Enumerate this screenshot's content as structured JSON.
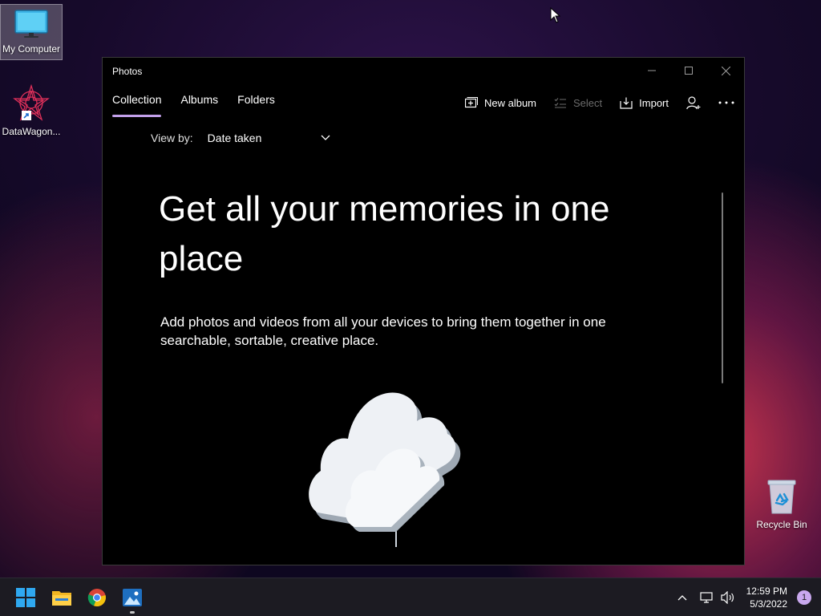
{
  "desktop": {
    "icons": [
      {
        "label": "My Computer",
        "icon": "monitor-icon"
      },
      {
        "label": "DataWagon...",
        "icon": "datawagon-icon"
      },
      {
        "label": "Recycle Bin",
        "icon": "recycle-bin-icon"
      }
    ]
  },
  "window": {
    "title": "Photos",
    "tabs": [
      {
        "label": "Collection",
        "active": true
      },
      {
        "label": "Albums",
        "active": false
      },
      {
        "label": "Folders",
        "active": false
      }
    ],
    "toolbar": {
      "new_album": "New album",
      "select": "Select",
      "import": "Import"
    },
    "view_by": {
      "label": "View by:",
      "value": "Date taken"
    },
    "hero": {
      "title": "Get all your memories in one place",
      "subtitle": "Add photos and videos from all your devices to bring them together in one searchable, sortable, creative place."
    }
  },
  "taskbar": {
    "apps": [
      "windows-start-icon",
      "file-explorer-icon",
      "chrome-icon",
      "photos-icon"
    ],
    "clock": {
      "time": "12:59 PM",
      "date": "5/3/2022"
    },
    "notifications": "1"
  },
  "colors": {
    "accent": "#c2a0ea",
    "window_bg": "#000000",
    "taskbar_bg": "#1c1b22"
  }
}
